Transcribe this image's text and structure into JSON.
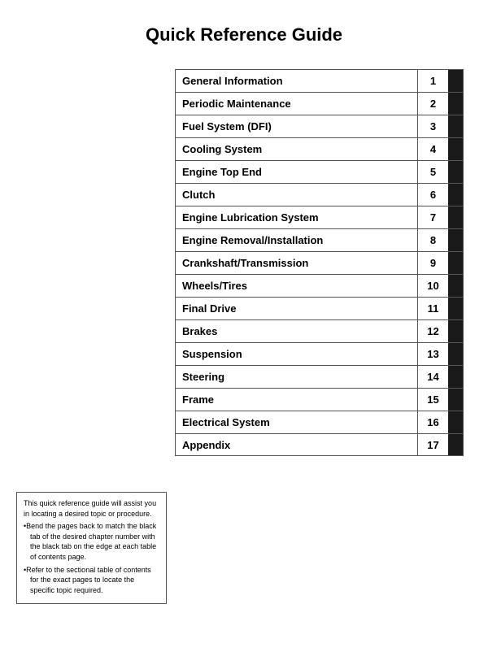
{
  "page": {
    "title": "Quick Reference Guide"
  },
  "toc": {
    "items": [
      {
        "label": "General Information",
        "number": "1"
      },
      {
        "label": "Periodic Maintenance",
        "number": "2"
      },
      {
        "label": "Fuel System (DFI)",
        "number": "3"
      },
      {
        "label": "Cooling System",
        "number": "4"
      },
      {
        "label": "Engine Top End",
        "number": "5"
      },
      {
        "label": "Clutch",
        "number": "6"
      },
      {
        "label": "Engine Lubrication System",
        "number": "7"
      },
      {
        "label": "Engine Removal/Installation",
        "number": "8"
      },
      {
        "label": "Crankshaft/Transmission",
        "number": "9"
      },
      {
        "label": "Wheels/Tires",
        "number": "10"
      },
      {
        "label": "Final Drive",
        "number": "11"
      },
      {
        "label": "Brakes",
        "number": "12"
      },
      {
        "label": "Suspension",
        "number": "13"
      },
      {
        "label": "Steering",
        "number": "14"
      },
      {
        "label": "Frame",
        "number": "15"
      },
      {
        "label": "Electrical System",
        "number": "16"
      },
      {
        "label": "Appendix",
        "number": "17"
      }
    ]
  },
  "note": {
    "line1": "This quick reference guide will assist you in locating a desired topic or procedure.",
    "bullet1": "•Bend the pages back to match the black tab of the desired chapter number with the black tab on the edge at each table of contents page.",
    "bullet2": "•Refer to the sectional table of contents for the exact pages to locate the specific topic required."
  }
}
